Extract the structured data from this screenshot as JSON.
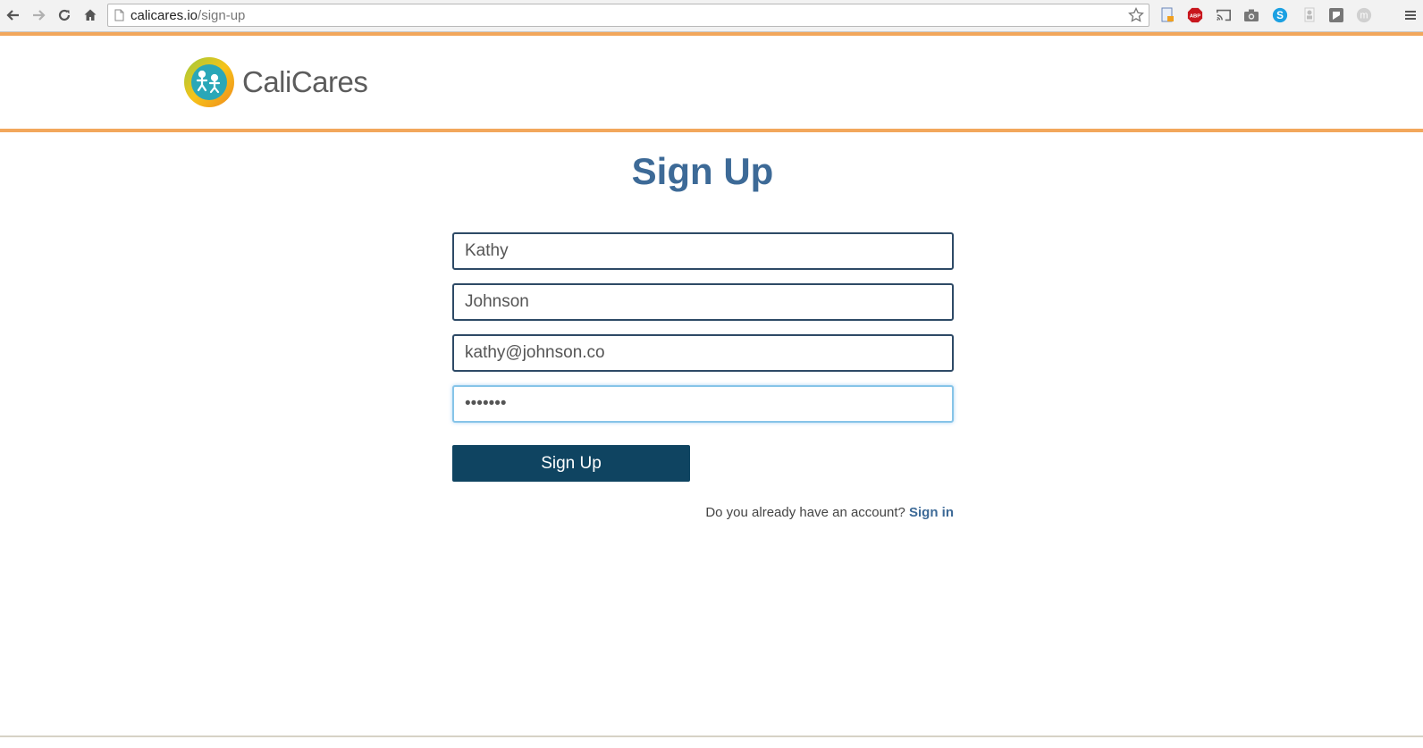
{
  "browser": {
    "url_host": "calicares.io",
    "url_path": "/sign-up",
    "nav_icons": [
      "back-arrow-icon",
      "forward-arrow-icon",
      "reload-icon",
      "home-icon"
    ],
    "extension_icons": [
      "doc-extension-icon",
      "adblock-icon",
      "cast-icon",
      "camera-icon",
      "skype-icon",
      "person-extension-icon",
      "shield-extension-icon",
      "circle-m-extension-icon",
      "menu-icon"
    ],
    "abp_label": "ABP",
    "skype_label": "S",
    "m_label": "m"
  },
  "header": {
    "brand_name": "CaliCares",
    "accent_color": "#f2a75c"
  },
  "form": {
    "title": "Sign Up",
    "first_name": "Kathy",
    "last_name": "Johnson",
    "email": "kathy@johnson.co",
    "password": "•••••••",
    "submit_label": "Sign Up",
    "signin_prompt": "Do you already have an account?",
    "signin_link": "Sign in"
  },
  "colors": {
    "title": "#3d6a97",
    "button": "#0f4461",
    "field_border": "#2e4a66",
    "focus_border": "#86c4e8"
  }
}
